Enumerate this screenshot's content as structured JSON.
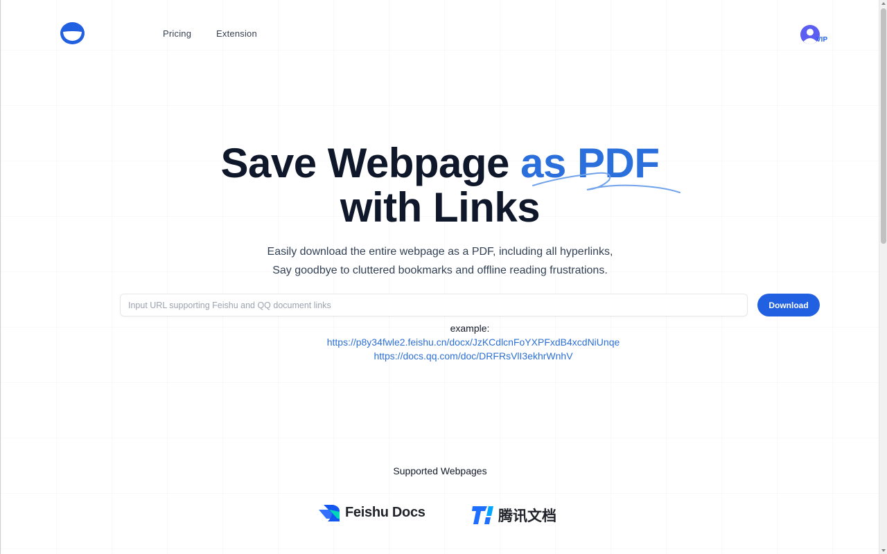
{
  "nav": {
    "logo_icon": "smile-logo-icon",
    "links": [
      {
        "label": "Pricing"
      },
      {
        "label": "Extension"
      }
    ],
    "account": {
      "icon": "user-avatar-icon",
      "badge": "VIP"
    }
  },
  "hero": {
    "title_part1": "Save Webpage ",
    "title_accent": "as PDF",
    "title_line2": "with Links",
    "subtitle_line1": "Easily download the entire webpage as a PDF, including all hyperlinks,",
    "subtitle_line2": "Say goodbye to cluttered bookmarks and offline reading frustrations."
  },
  "form": {
    "url_value": "",
    "url_placeholder": "Input URL supporting Feishu and QQ document links",
    "download_label": "Download"
  },
  "examples": {
    "label": "example:",
    "links": [
      "https://p8y34fwle2.feishu.cn/docx/JzKCdlcnFoYXPFxdB4xcdNiUnqe",
      "https://docs.qq.com/doc/DRFRsVlI3ekhrWnhV"
    ]
  },
  "supported": {
    "heading": "Supported Webpages",
    "logos": [
      {
        "name": "Feishu Docs",
        "icon": "feishu-docs-icon"
      },
      {
        "name": "腾讯文档",
        "icon": "tencent-docs-icon"
      }
    ]
  },
  "colors": {
    "accent": "#2b6fdc",
    "button": "#2160e0",
    "title": "#0f172a"
  }
}
